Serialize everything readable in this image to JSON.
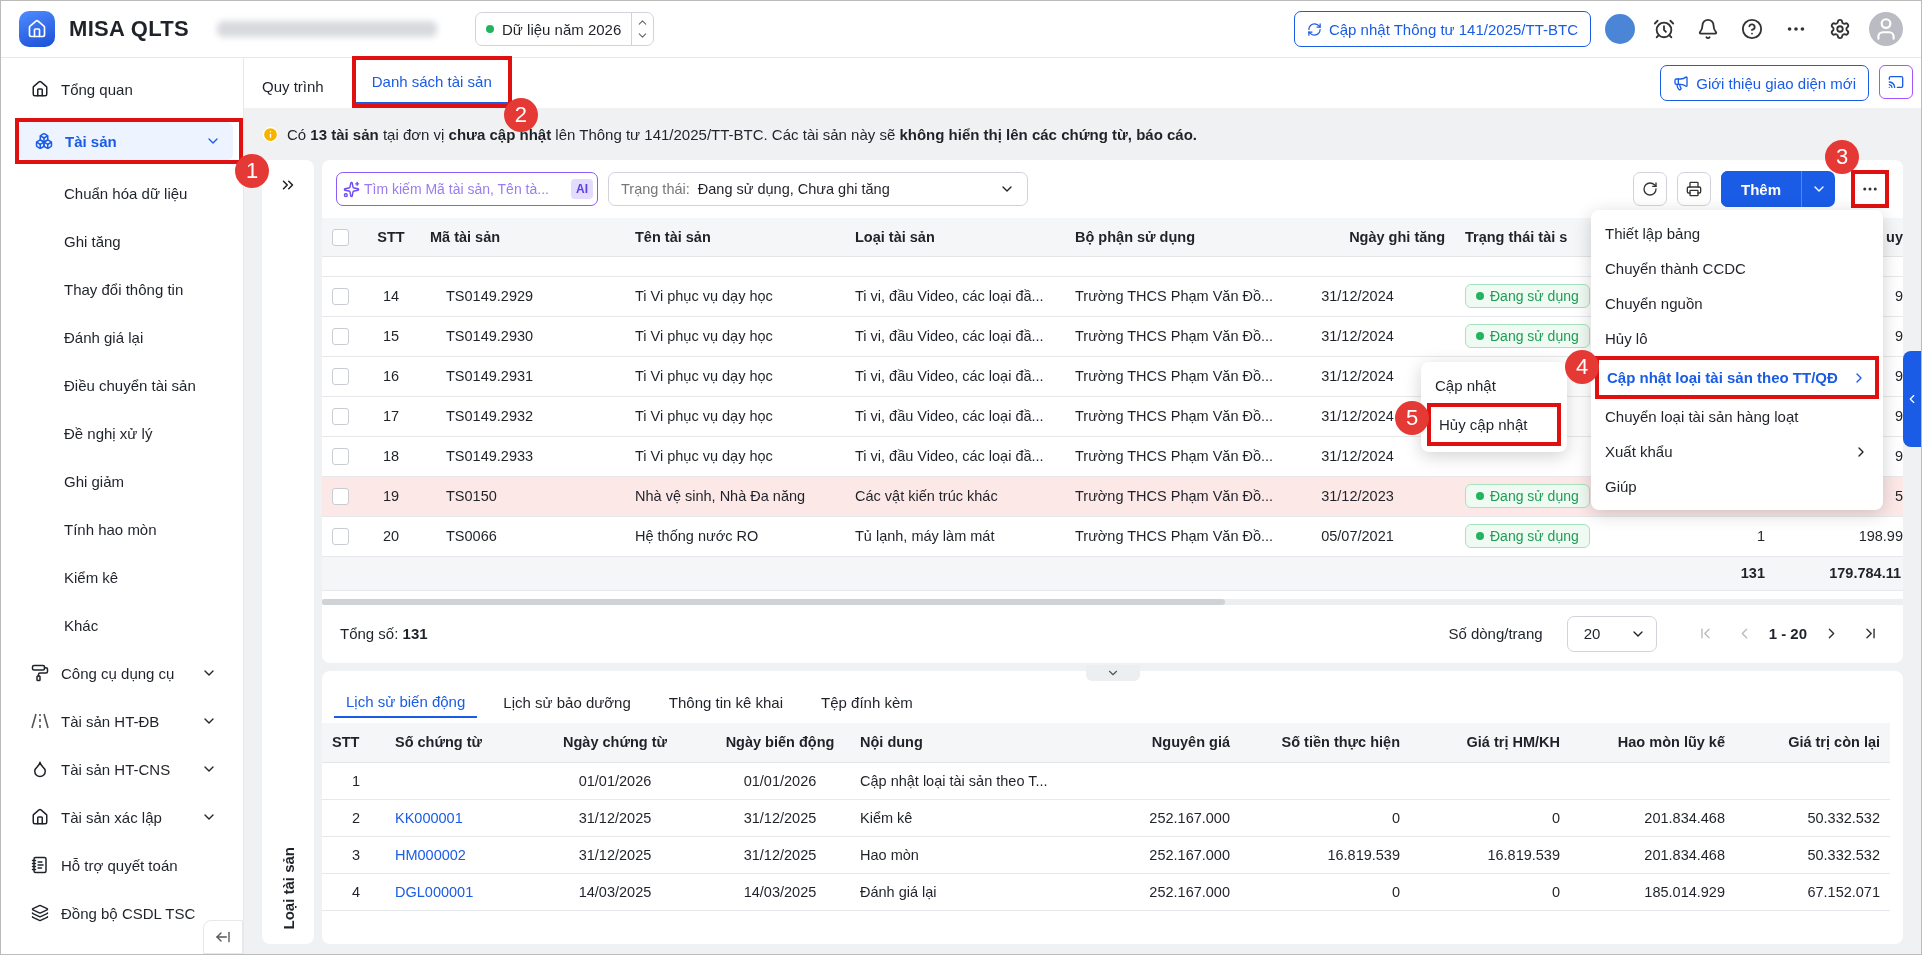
{
  "app": {
    "name": "MISA QLTS",
    "year_selector": "Dữ liệu năm 2026",
    "update_button": "Cập nhật Thông tư 141/2025/TT-BTC"
  },
  "sidebar": {
    "items": [
      {
        "label": "Tổng quan",
        "kind": "overview",
        "selected": false
      },
      {
        "label": "Tài sản",
        "kind": "assets",
        "selected": true,
        "expandable": true,
        "expanded": true,
        "callout": "1",
        "children": [
          {
            "label": "Chuẩn hóa dữ liệu"
          },
          {
            "label": "Ghi tăng"
          },
          {
            "label": "Thay đổi thông tin"
          },
          {
            "label": "Đánh giá lại"
          },
          {
            "label": "Điều chuyển tài sản"
          },
          {
            "label": "Đề nghị xử lý"
          },
          {
            "label": "Ghi giảm"
          },
          {
            "label": "Tính hao mòn"
          },
          {
            "label": "Kiểm kê"
          },
          {
            "label": "Khác"
          }
        ]
      },
      {
        "label": "Công cụ dụng cụ",
        "kind": "tools",
        "selected": false,
        "expandable": true
      },
      {
        "label": "Tài sản HT-ĐB",
        "kind": "road",
        "selected": false,
        "expandable": true
      },
      {
        "label": "Tài sản HT-CNS",
        "kind": "water",
        "selected": false,
        "expandable": true
      },
      {
        "label": "Tài sản xác lập",
        "kind": "overview",
        "selected": false,
        "expandable": true
      },
      {
        "label": "Hỗ trợ quyết toán",
        "kind": "book",
        "selected": false
      },
      {
        "label": "Đồng bộ CSDL TSC",
        "kind": "sync",
        "selected": false
      }
    ]
  },
  "page_tabs": [
    {
      "label": "Quy trình",
      "selected": false
    },
    {
      "label": "Danh sách tài sản",
      "selected": true,
      "callout": "2"
    }
  ],
  "intro_button": "Giới thiệu giao diện mới",
  "notice": "Có **13 tài sản** tại đơn vị **chưa cập nhật** lên Thông tư 141/2025/TT-BTC. Các tài sản này sẽ **không hiển thị lên các chứng từ, báo cáo.**",
  "side_panel_label": "Loại tài sản",
  "toolbar": {
    "search_placeholder": "Tìm kiếm Mã tài sản, Tên tà...",
    "ai_badge": "AI",
    "filter_label": "Trạng thái:",
    "filter_value": "Đang sử dụng, Chưa ghi tăng",
    "add_button": "Thêm",
    "more_callout": "3"
  },
  "asset_table": {
    "columns": [
      "STT",
      "Mã tài sản",
      "Tên tài sản",
      "Loại tài sản",
      "Bộ phận sử dụng",
      "Ngày ghi tăng",
      "Trạng thái tài s"
    ],
    "cut_column_label": "uy",
    "select_all_checked": false,
    "rows": [
      {
        "stt": "14",
        "code": "TS0149.2929",
        "name": "Ti Vi phục vụ dạy học",
        "type": "Ti vi, đầu Video, các loại đầ...",
        "department": "Trường THCS Phạm Văn Đồ...",
        "date": "31/12/2024",
        "status": "Đang sử dụng",
        "value": "9",
        "checked": false,
        "flagged": false
      },
      {
        "stt": "15",
        "code": "TS0149.2930",
        "name": "Ti Vi phục vụ dạy học",
        "type": "Ti vi, đầu Video, các loại đầ...",
        "department": "Trường THCS Phạm Văn Đồ...",
        "date": "31/12/2024",
        "status": "Đang sử dụng",
        "value": "9",
        "checked": false,
        "flagged": false
      },
      {
        "stt": "16",
        "code": "TS0149.2931",
        "name": "Ti Vi phục vụ dạy học",
        "type": "Ti vi, đầu Video, các loại đầ...",
        "department": "Trường THCS Phạm Văn Đồ...",
        "date": "31/12/2024",
        "value": "9",
        "checked": false,
        "flagged": false
      },
      {
        "stt": "17",
        "code": "TS0149.2932",
        "name": "Ti Vi phục vụ dạy học",
        "type": "Ti vi, đầu Video, các loại đầ...",
        "department": "Trường THCS Phạm Văn Đồ...",
        "date": "31/12/2024",
        "value": "9",
        "checked": false,
        "flagged": false
      },
      {
        "stt": "18",
        "code": "TS0149.2933",
        "name": "Ti Vi phục vụ dạy học",
        "type": "Ti vi, đầu Video, các loại đầ...",
        "department": "Trường THCS Phạm Văn Đồ...",
        "date": "31/12/2024",
        "value": "9",
        "checked": false,
        "flagged": false
      },
      {
        "stt": "19",
        "code": "TS0150",
        "name": "Nhà vệ sinh, Nhà Đa năng",
        "type": "Các vật kiến trúc khác",
        "department": "Trường THCS Phạm Văn Đồ...",
        "date": "31/12/2023",
        "status": "Đang sử dụng",
        "value": "5",
        "checked": false,
        "flagged": true
      },
      {
        "stt": "20",
        "code": "TS0066",
        "name": "Hệ thống nước RO",
        "type": "Tủ lạnh, máy làm mát",
        "department": "Trường THCS Phạm Văn Đồ...",
        "date": "05/07/2021",
        "status": "Đang sử dụng",
        "quantity": "1",
        "value": "198.99",
        "checked": false,
        "flagged": false
      }
    ],
    "totals": {
      "quantity": "131",
      "value": "179.784.11"
    }
  },
  "footer": {
    "total_label": "Tổng số:",
    "total": "131",
    "page_size_label": "Số dòng/trang",
    "page_size": "20",
    "range": "1 - 20"
  },
  "menu": {
    "items": [
      {
        "label": "Thiết lập bảng",
        "selected": false
      },
      {
        "label": "Chuyển thành CCDC",
        "selected": false
      },
      {
        "label": "Chuyển nguồn",
        "selected": false
      },
      {
        "label": "Hủy lô",
        "selected": false
      },
      {
        "label": "Cập nhật loại tài sản theo TT/QĐ",
        "selected": true,
        "has_submenu": true,
        "callout": "4"
      },
      {
        "label": "Chuyển loại tài sản hàng loạt",
        "selected": false
      },
      {
        "label": "Xuất khẩu",
        "selected": false,
        "has_submenu": true
      },
      {
        "label": "Giúp",
        "selected": false
      }
    ]
  },
  "submenu": {
    "items": [
      {
        "label": "Cập nhật",
        "selected": false
      },
      {
        "label": "Hủy cập nhật",
        "selected": false,
        "callout": "5"
      }
    ]
  },
  "detail_tabs": [
    {
      "label": "Lịch sử biến động",
      "selected": true
    },
    {
      "label": "Lịch sử bảo dưỡng",
      "selected": false
    },
    {
      "label": "Thông tin kê khai",
      "selected": false
    },
    {
      "label": "Tệp đính kèm",
      "selected": false
    }
  ],
  "history_table": {
    "columns": [
      "STT",
      "Số chứng từ",
      "Ngày chứng từ",
      "Ngày biến động",
      "Nội dung",
      "Nguyên giá",
      "Số tiền thực hiện",
      "Giá trị HM/KH",
      "Hao mòn lũy kế",
      "Giá trị còn lại"
    ],
    "rows": [
      [
        "1",
        "",
        "01/01/2026",
        "01/01/2026",
        "Cập nhật loại tài sản theo T...",
        "",
        "",
        "",
        "",
        ""
      ],
      [
        "2",
        "KK000001",
        "31/12/2025",
        "31/12/2025",
        "Kiểm kê",
        "252.167.000",
        "0",
        "0",
        "201.834.468",
        "50.332.532"
      ],
      [
        "3",
        "HM000002",
        "31/12/2025",
        "31/12/2025",
        "Hao mòn",
        "252.167.000",
        "16.819.539",
        "16.819.539",
        "201.834.468",
        "50.332.532"
      ],
      [
        "4",
        "DGL000001",
        "14/03/2025",
        "14/03/2025",
        "Đánh giá lại",
        "252.167.000",
        "0",
        "0",
        "185.014.929",
        "67.152.071"
      ]
    ]
  }
}
